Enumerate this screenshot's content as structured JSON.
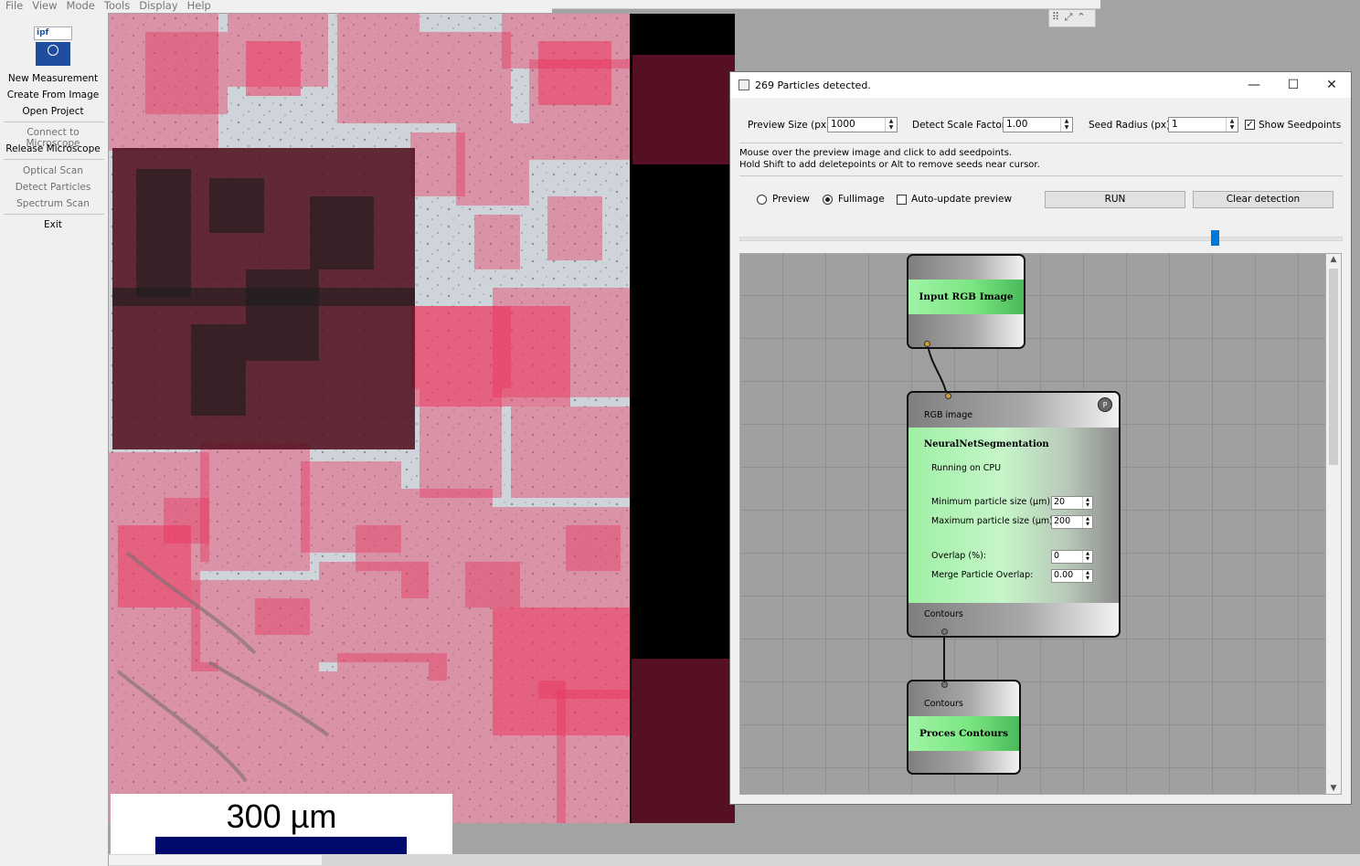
{
  "menu": [
    "File",
    "View",
    "Mode",
    "Tools",
    "Display",
    "Help"
  ],
  "sidebar": {
    "logo_text": "ipf",
    "items": [
      {
        "label": "New Measurement",
        "enabled": true
      },
      {
        "label": "Create From Image",
        "enabled": true
      },
      {
        "label": "Open Project",
        "enabled": true
      },
      {
        "label": "Connect to Microscope",
        "enabled": false
      },
      {
        "label": "Release Microscope",
        "enabled": true
      },
      {
        "label": "Optical Scan",
        "enabled": false
      },
      {
        "label": "Detect Particles",
        "enabled": false
      },
      {
        "label": "Spectrum Scan",
        "enabled": false
      },
      {
        "label": "Exit",
        "enabled": true
      }
    ]
  },
  "scale_bar": {
    "label": "300 µm"
  },
  "dialog": {
    "title": "269 Particles detected.",
    "preview_size_label": "Preview Size (px):",
    "preview_size_value": "1000",
    "detect_scale_label": "Detect Scale Factor:",
    "detect_scale_value": "1.00",
    "seed_radius_label": "Seed Radius (px):",
    "seed_radius_value": "1",
    "show_seedpoints_label": "Show Seedpoints",
    "show_seedpoints_checked": true,
    "info_line1": "Mouse over the preview image and click to add seedpoints.",
    "info_line2": "Hold Shift to add deletepoints or Alt to remove seeds near cursor.",
    "radio_preview": "Preview",
    "radio_fullimage": "Fullimage",
    "selected_mode": "Fullimage",
    "auto_update_label": "Auto-update preview",
    "auto_update_checked": false,
    "run_label": "RUN",
    "clear_label": "Clear detection",
    "slider_value": 0.79
  },
  "nodes": {
    "input": {
      "title": "Input RGB Image"
    },
    "nn": {
      "port_badge": "P",
      "input_label": "RGB image",
      "title": "NeuralNetSegmentation",
      "status": "Running on CPU",
      "min_size_label": "Minimum particle size (µm):",
      "min_size_value": "20",
      "max_size_label": "Maximum particle size (µm):",
      "max_size_value": "200",
      "overlap_label": "Overlap (%):",
      "overlap_value": "0",
      "merge_label": "Merge Particle Overlap:",
      "merge_value": "0.00",
      "output_label": "Contours"
    },
    "process": {
      "input_label": "Contours",
      "title": "Proces Contours"
    }
  }
}
